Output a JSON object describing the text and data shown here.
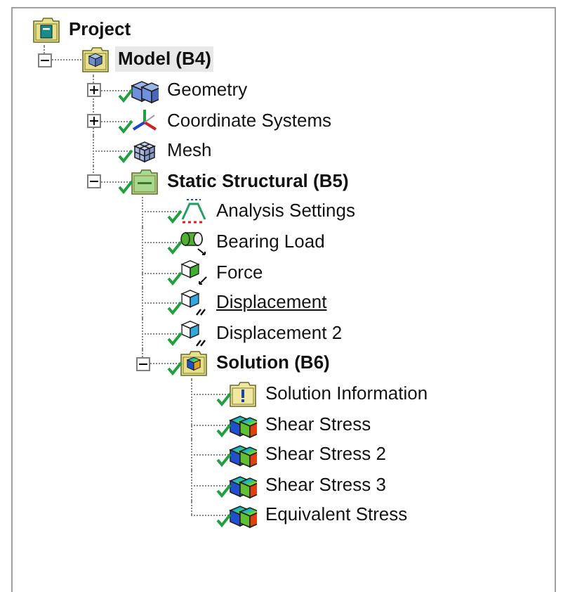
{
  "tree": [
    {
      "label": "Project",
      "kind": "project",
      "bold": true,
      "selected": false,
      "hovered": false,
      "solved": false,
      "children": [
        {
          "label": "Model (B4)",
          "kind": "model",
          "bold": true,
          "selected": true,
          "hovered": false,
          "solved": false,
          "expanded": true,
          "children": [
            {
              "label": "Geometry",
              "kind": "geometry",
              "bold": false,
              "selected": false,
              "hovered": false,
              "solved": true,
              "expanded": false
            },
            {
              "label": "Coordinate Systems",
              "kind": "coordinate",
              "bold": false,
              "selected": false,
              "hovered": false,
              "solved": true,
              "expanded": false
            },
            {
              "label": "Mesh",
              "kind": "mesh",
              "bold": false,
              "selected": false,
              "hovered": false,
              "solved": true
            },
            {
              "label": "Static Structural (B5)",
              "kind": "analysis",
              "bold": true,
              "selected": false,
              "hovered": false,
              "solved": true,
              "expanded": true,
              "children": [
                {
                  "label": "Analysis Settings",
                  "kind": "settings",
                  "bold": false,
                  "selected": false,
                  "hovered": false,
                  "solved": true
                },
                {
                  "label": "Bearing Load",
                  "kind": "bearing",
                  "bold": false,
                  "selected": false,
                  "hovered": false,
                  "solved": true
                },
                {
                  "label": "Force",
                  "kind": "force",
                  "bold": false,
                  "selected": false,
                  "hovered": false,
                  "solved": true
                },
                {
                  "label": "Displacement",
                  "kind": "displacement",
                  "bold": false,
                  "selected": false,
                  "hovered": true,
                  "solved": true
                },
                {
                  "label": "Displacement 2",
                  "kind": "displacement",
                  "bold": false,
                  "selected": false,
                  "hovered": false,
                  "solved": true
                },
                {
                  "label": "Solution (B6)",
                  "kind": "solution",
                  "bold": true,
                  "selected": false,
                  "hovered": false,
                  "solved": true,
                  "expanded": true,
                  "children": [
                    {
                      "label": "Solution Information",
                      "kind": "info",
                      "bold": false,
                      "selected": false,
                      "hovered": false,
                      "solved": true
                    },
                    {
                      "label": "Shear Stress",
                      "kind": "result",
                      "bold": false,
                      "selected": false,
                      "hovered": false,
                      "solved": true
                    },
                    {
                      "label": "Shear Stress 2",
                      "kind": "result",
                      "bold": false,
                      "selected": false,
                      "hovered": false,
                      "solved": true
                    },
                    {
                      "label": "Shear Stress 3",
                      "kind": "result",
                      "bold": false,
                      "selected": false,
                      "hovered": false,
                      "solved": true
                    },
                    {
                      "label": "Equivalent Stress",
                      "kind": "result",
                      "bold": false,
                      "selected": false,
                      "hovered": false,
                      "solved": true
                    }
                  ]
                }
              ]
            }
          ]
        }
      ]
    }
  ]
}
